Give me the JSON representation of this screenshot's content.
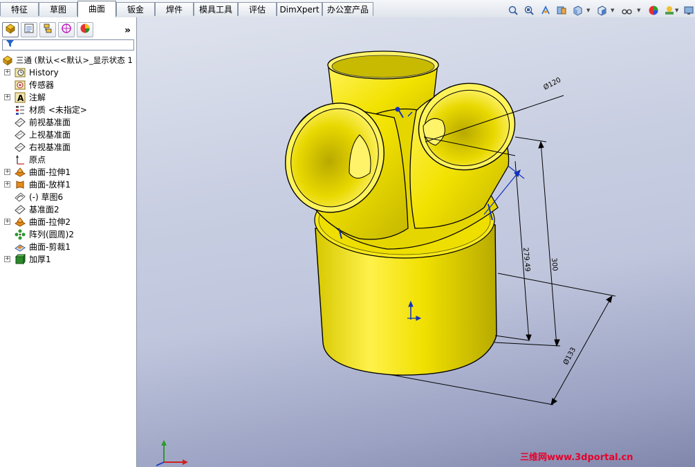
{
  "tabs": [
    {
      "label": "特征"
    },
    {
      "label": "草图"
    },
    {
      "label": "曲面"
    },
    {
      "label": "钣金"
    },
    {
      "label": "焊件"
    },
    {
      "label": "模具工具"
    },
    {
      "label": "评估"
    },
    {
      "label": "DimXpert"
    },
    {
      "label": "办公室产品"
    }
  ],
  "active_tab": "曲面",
  "toolbar_icons": [
    "zoom-to-fit-icon",
    "zoom-area-icon",
    "previous-view-icon",
    "section-view-icon",
    "view-orientation-icon",
    "display-style-icon",
    "hide-show-icon",
    "appearance-icon",
    "scene-icon",
    "monitor-icon"
  ],
  "panel": {
    "tabs": [
      "feature-manager-icon",
      "property-manager-icon",
      "configuration-manager-icon",
      "dimxpert-manager-icon",
      "display-manager-icon"
    ],
    "expand_label": "»",
    "filter_icon": "filter-icon"
  },
  "tree": {
    "root": "三通 (默认<<默认>_显示状态 1",
    "items": [
      {
        "label": "History",
        "icon": "history-icon"
      },
      {
        "label": "传感器",
        "icon": "sensor-icon"
      },
      {
        "label": "注解",
        "icon": "annotation-icon"
      },
      {
        "label": "材质 <未指定>",
        "icon": "material-icon"
      },
      {
        "label": "前视基准面",
        "icon": "plane-icon"
      },
      {
        "label": "上视基准面",
        "icon": "plane-icon"
      },
      {
        "label": "右视基准面",
        "icon": "plane-icon"
      },
      {
        "label": "原点",
        "icon": "origin-icon"
      },
      {
        "label": "曲面-拉伸1",
        "icon": "surface-extrude-icon"
      },
      {
        "label": "曲面-放样1",
        "icon": "surface-loft-icon"
      },
      {
        "label": "(-) 草图6",
        "icon": "sketch-icon"
      },
      {
        "label": "基准面2",
        "icon": "plane-icon"
      },
      {
        "label": "曲面-拉伸2",
        "icon": "surface-extrude-icon"
      },
      {
        "label": "阵列(圆周)2",
        "icon": "circular-pattern-icon"
      },
      {
        "label": "曲面-剪裁1",
        "icon": "surface-trim-icon"
      },
      {
        "label": "加厚1",
        "icon": "thicken-icon"
      }
    ]
  },
  "dimensions": {
    "top_diameter": "Ø120",
    "inner_length": "279.49",
    "total_length": "300",
    "bottom_diameter": "Ø133"
  },
  "colors": {
    "part_yellow": "#f0e000",
    "part_shade": "#c8b800",
    "dim_black": "#000000",
    "dim_blue": "#1030c0",
    "watermark_red": "#e8002a"
  },
  "watermark": "三维网www.3dportal.cn"
}
